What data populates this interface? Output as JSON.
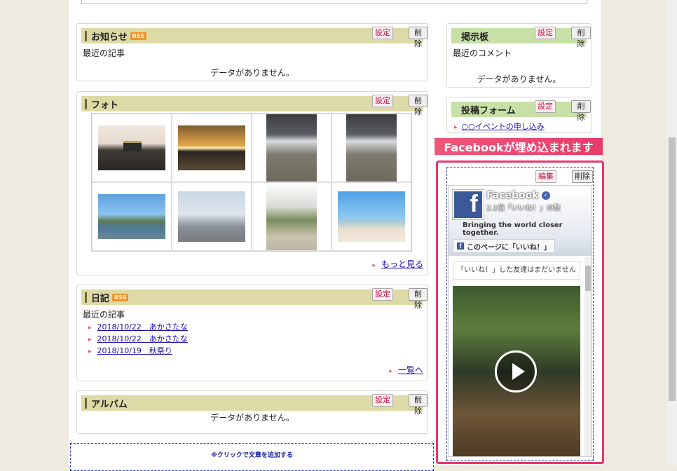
{
  "buttons": {
    "set": "設定",
    "delete": "削除",
    "edit": "編集"
  },
  "oshirase": {
    "title": "お知らせ",
    "rss": "RSS",
    "subtitle": "最近の記事",
    "empty": "データがありません。"
  },
  "photo": {
    "title": "フォト",
    "more": "もっと見る"
  },
  "diary": {
    "title": "日記",
    "rss": "RSS",
    "subtitle": "最近の記事",
    "items": [
      "2018/10/22　あかさたな",
      "2018/10/22　あかさたな",
      "2018/10/19　秋祭り"
    ],
    "more": "一覧へ"
  },
  "album": {
    "title": "アルバム",
    "empty": "データがありません。"
  },
  "keijiban": {
    "title": "掲示板",
    "subtitle": "最近のコメント",
    "empty": "データがありません。"
  },
  "form": {
    "title": "投稿フォーム",
    "link": "○○イベントの申し込み"
  },
  "annotation": "Facebookが埋め込まれます",
  "facebook": {
    "name": "Facebook",
    "likes": "2.1億「いいね！」の数",
    "tagline": "Bringing the world closer together.",
    "like_button": "このページに「いいね！」",
    "friends": "「いいね！」した友達はまだいません"
  },
  "add_text": "※クリックで文章を追加する"
}
